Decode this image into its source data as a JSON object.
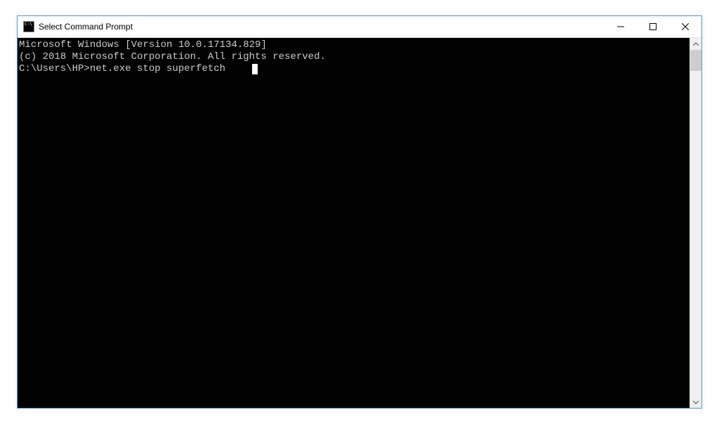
{
  "window": {
    "title": "Select Command Prompt"
  },
  "terminal": {
    "line1": "Microsoft Windows [Version 10.0.17134.829]",
    "line2": "(c) 2018 Microsoft Corporation. All rights reserved.",
    "blank": "",
    "prompt": "C:\\Users\\HP>",
    "command": "net.exe stop superfetch"
  }
}
